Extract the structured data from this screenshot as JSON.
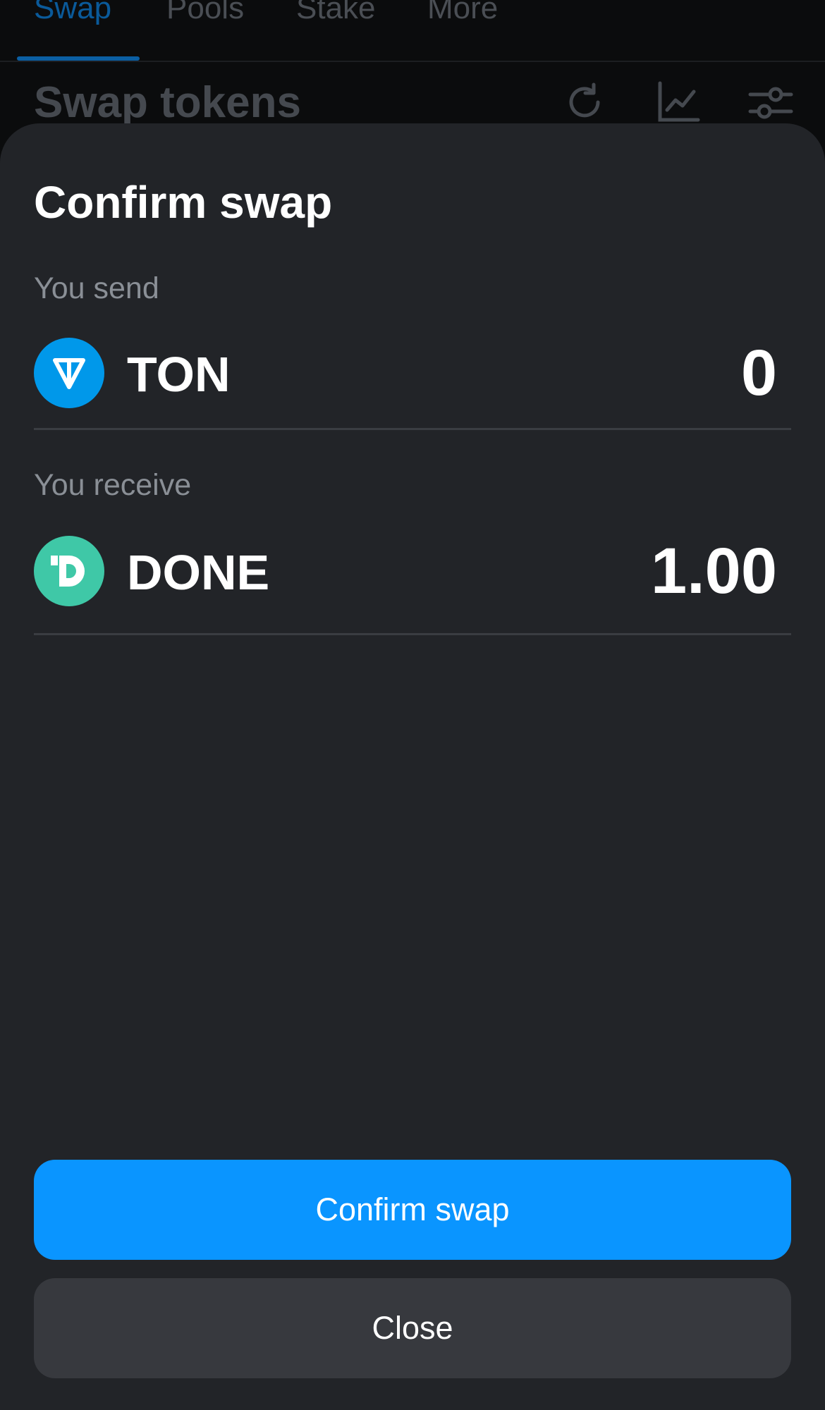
{
  "nav": {
    "tabs": [
      {
        "label": "Swap"
      },
      {
        "label": "Pools"
      },
      {
        "label": "Stake"
      },
      {
        "label": "More"
      }
    ]
  },
  "background": {
    "title": "Swap tokens"
  },
  "modal": {
    "title": "Confirm swap",
    "send": {
      "label": "You send",
      "token": "TON",
      "amount": "0",
      "logo_color": "#0098ea"
    },
    "receive": {
      "label": "You receive",
      "token": "DONE",
      "amount": "1.00",
      "logo_color": "#3fc8a7"
    },
    "confirm_label": "Confirm swap",
    "close_label": "Close"
  },
  "colors": {
    "accent": "#0a95ff",
    "sheet_bg": "#222428",
    "secondary_button": "#37393e"
  },
  "icons": [
    "refresh-icon",
    "chart-icon",
    "settings-sliders-icon",
    "ton-logo-icon",
    "done-logo-icon"
  ]
}
